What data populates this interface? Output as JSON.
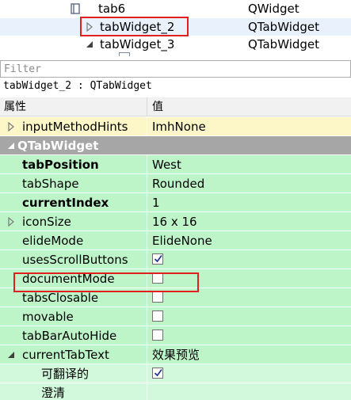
{
  "tree": {
    "rows": [
      {
        "name": "tab6",
        "class": "QWidget"
      },
      {
        "name": "tabWidget_2",
        "class": "QTabWidget"
      },
      {
        "name": "tabWidget_3",
        "class": "QTabWidget"
      }
    ]
  },
  "filter": {
    "placeholder": "Filter",
    "value": ""
  },
  "caption": "tabWidget_2 : QTabWidget",
  "header": {
    "property": "属性",
    "value": "值"
  },
  "properties": [
    {
      "name": "inputMethodHints",
      "value": "ImhNone"
    },
    {
      "name": "QTabWidget"
    },
    {
      "name": "tabPosition",
      "value": "West"
    },
    {
      "name": "tabShape",
      "value": "Rounded"
    },
    {
      "name": "currentIndex",
      "value": "1"
    },
    {
      "name": "iconSize",
      "value": "16 x 16"
    },
    {
      "name": "elideMode",
      "value": "ElideNone"
    },
    {
      "name": "usesScrollButtons",
      "checked": true
    },
    {
      "name": "documentMode",
      "checked": false
    },
    {
      "name": "tabsClosable",
      "checked": false
    },
    {
      "name": "movable",
      "checked": false
    },
    {
      "name": "tabBarAutoHide",
      "checked": false
    },
    {
      "name": "currentTabText",
      "value": "效果预览"
    },
    {
      "name": "可翻译的",
      "checked": true
    },
    {
      "name": "澄清"
    }
  ],
  "colors": {
    "highlight_box": "#e0201c",
    "group_header": "#a6a6a6",
    "row_green": "#bdf5c8",
    "row_green_light": "#d3f9dc",
    "row_yellow": "#fdf6c6",
    "tree_selected_row": "#e9f2fc"
  },
  "icons": [
    "folder-icon",
    "expand-arrow-icon",
    "collapse-arrow-icon",
    "checkmark-icon"
  ]
}
